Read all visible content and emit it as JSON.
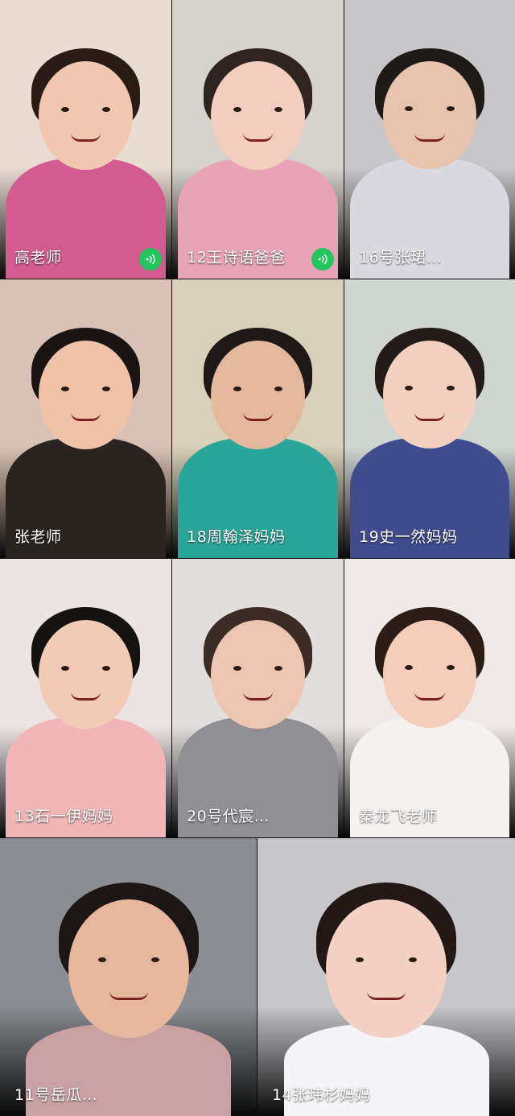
{
  "participants": [
    {
      "name": "高老师",
      "speaking": true,
      "bg": "#e9ddd3",
      "skin": "#f1c7b1",
      "hair": "#2a1b15",
      "shirt": "#d35b8f"
    },
    {
      "name": "12王诗语爸爸",
      "speaking": true,
      "bg": "#d6d2cc",
      "skin": "#f3cdbd",
      "hair": "#2f2420",
      "shirt": "#e9a3b7"
    },
    {
      "name": "16号张珺…",
      "speaking": false,
      "bg": "#c7c7c9",
      "skin": "#e8c3ad",
      "hair": "#1e1a18",
      "shirt": "#d9d9df"
    },
    {
      "name": "张老师",
      "speaking": false,
      "bg": "#d9c2b5",
      "skin": "#f0c3a8",
      "hair": "#1a1513",
      "shirt": "#2a2420"
    },
    {
      "name": "18周翰泽妈妈",
      "speaking": false,
      "bg": "#d8d0b8",
      "skin": "#e3b89c",
      "hair": "#1e1816",
      "shirt": "#2aa59a"
    },
    {
      "name": "19史一然妈妈",
      "speaking": false,
      "bg": "#cfd6d2",
      "skin": "#f3d0bf",
      "hair": "#231b17",
      "shirt": "#3f4d8f"
    },
    {
      "name": "13石一伊妈妈",
      "speaking": false,
      "bg": "#ece4e3",
      "skin": "#f2cbb6",
      "hair": "#151212",
      "shirt": "#f1b6b6"
    },
    {
      "name": "20号代宸…",
      "speaking": false,
      "bg": "#e2dedd",
      "skin": "#ecc6b2",
      "hair": "#3b2c26",
      "shirt": "#8f8f94"
    },
    {
      "name": "秦龙飞老师",
      "speaking": false,
      "bg": "#efe9e7",
      "skin": "#f4cdbb",
      "hair": "#2b1c15",
      "shirt": "#f4f1ef"
    },
    {
      "name": "11号岳瓜…",
      "speaking": false,
      "bg": "#8a8d92",
      "skin": "#e6b79d",
      "hair": "#1c1615",
      "shirt": "#c9a1a3"
    },
    {
      "name": "14张玮杉妈妈",
      "speaking": false,
      "bg": "#c8c7cb",
      "skin": "#f4d1c2",
      "hair": "#231813",
      "shirt": "#f5f4f7"
    }
  ]
}
